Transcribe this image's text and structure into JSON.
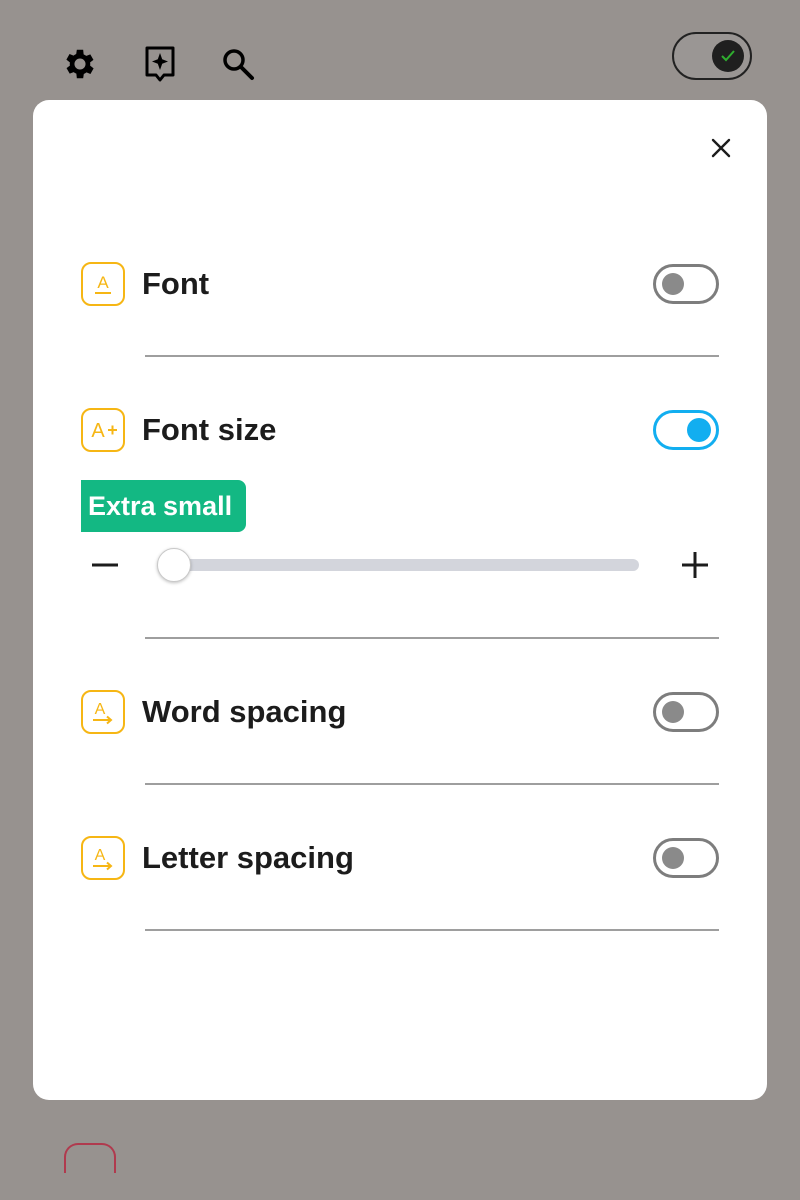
{
  "background": {
    "toolbar": {
      "icons": [
        "gear-icon",
        "sparkle-bookmark-icon",
        "search-icon"
      ],
      "toggle_on": true
    }
  },
  "modal": {
    "close_icon": "close-icon",
    "settings": [
      {
        "id": "font",
        "label": "Font",
        "icon": "font-underline-icon",
        "enabled": false
      },
      {
        "id": "font-size",
        "label": "Font size",
        "icon": "font-size-plus-icon",
        "enabled": true
      },
      {
        "id": "word-spacing",
        "label": "Word spacing",
        "icon": "word-spacing-icon",
        "enabled": false
      },
      {
        "id": "letter-spacing",
        "label": "Letter spacing",
        "icon": "letter-spacing-icon",
        "enabled": false
      }
    ],
    "font_size": {
      "current_label": "Extra small",
      "level": 0,
      "decrease_icon": "minus-icon",
      "increase_icon": "plus-icon"
    }
  },
  "colors": {
    "overlay": "#97928f",
    "accent_yellow": "#f6b614",
    "toggle_on": "#12aef0",
    "badge_green": "#13b883"
  }
}
